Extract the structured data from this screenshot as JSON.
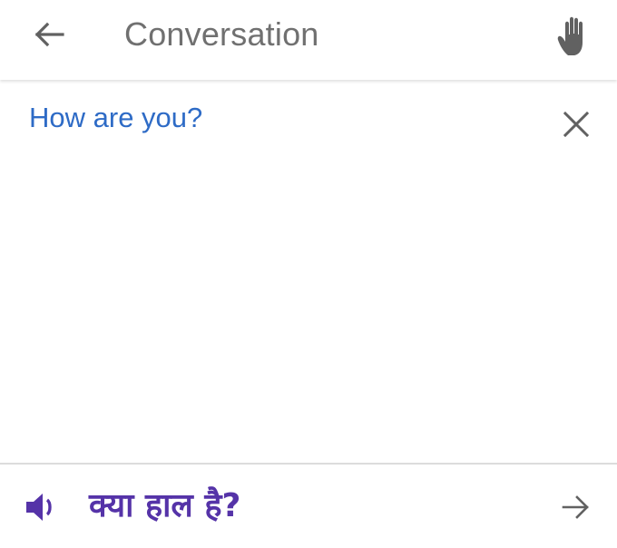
{
  "header": {
    "title": "Conversation",
    "back_icon": "arrow-left-icon",
    "mode_icon": "hand-icon"
  },
  "source": {
    "text": "How are you?",
    "clear_icon": "close-icon"
  },
  "result": {
    "translation": "क्या हाल है?",
    "speak_icon": "speaker-icon",
    "open_icon": "arrow-right-icon"
  },
  "colors": {
    "source_text": "#2e6bc6",
    "translation_text": "#5533a8",
    "speaker_icon": "#5533a8",
    "icon_gray": "#616161",
    "title_gray": "#707070",
    "divider": "#dcdcdc"
  }
}
